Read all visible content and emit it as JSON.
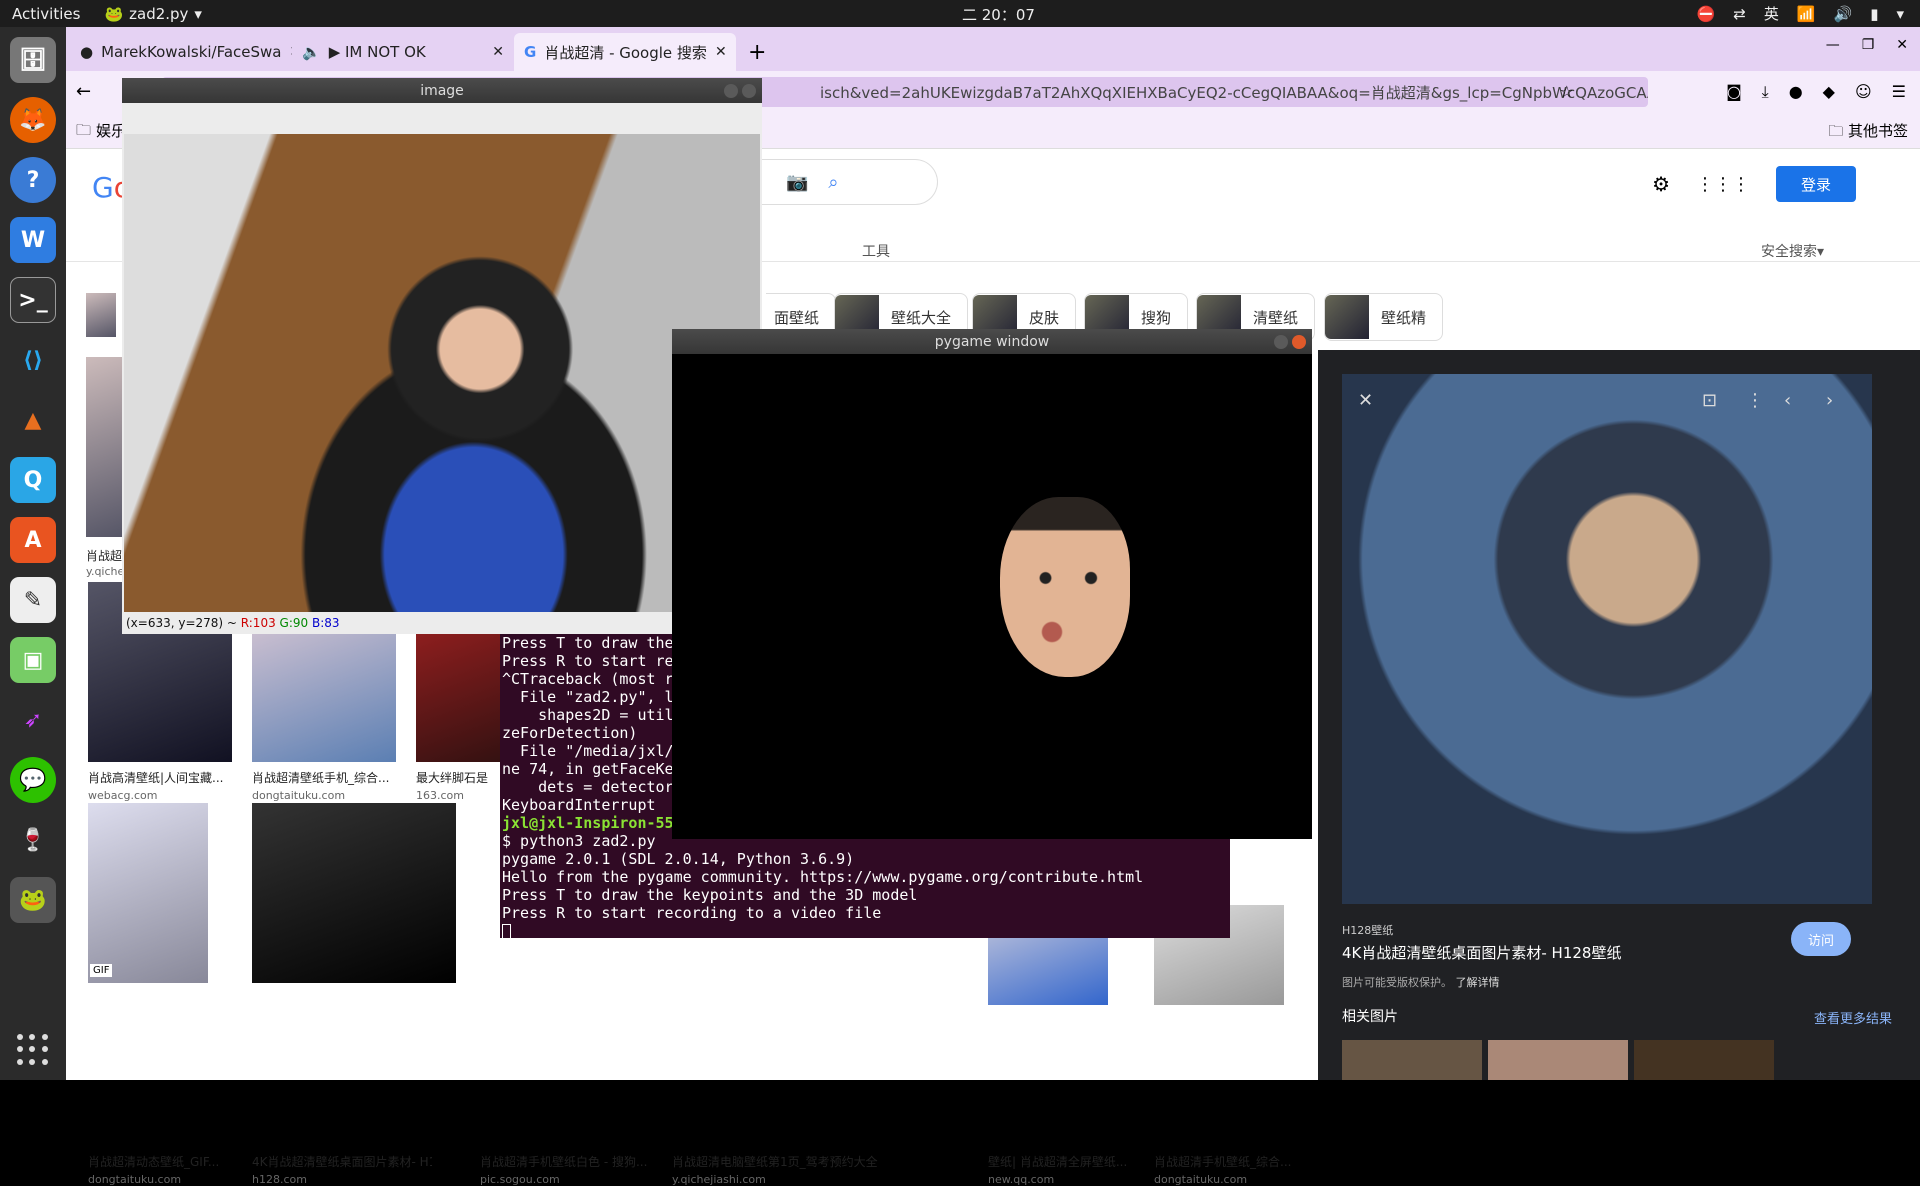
{
  "topbar": {
    "activities": "Activities",
    "app": "zad2.py",
    "clock": "二 20：07",
    "lang": "英"
  },
  "browser": {
    "tabs": [
      {
        "label": "MarekKowalski/FaceSwa"
      },
      {
        "label": "▶ IM NOT OK"
      },
      {
        "label": "肖战超清 - Google 搜索"
      }
    ],
    "url": "isch&ved=2ahUKEwizgdaB7aT2AhXQqXIEHXBaCyEQ2-cCegQIABAA&oq=肖战超清&gs_lcp=CgNpbWcQAzoGCAA",
    "bookmark_left": "娱乐",
    "bookmark_right": "其他书签",
    "tools": "工具",
    "safe": "安全搜索▾",
    "login": "登录",
    "chips": [
      "面壁纸",
      "壁纸大全",
      "皮肤",
      "搜狗",
      "清壁纸",
      "壁纸精"
    ],
    "results": [
      {
        "cap": "肖战超",
        "src": "y.qiche"
      },
      {
        "cap": "肖战高清壁纸|人间宝藏...",
        "src": "webacg.com"
      },
      {
        "cap": "肖战超清壁纸手机_综合...",
        "src": "dongtaituku.com"
      },
      {
        "cap": "最大绊脚石是",
        "src": "163.com"
      },
      {
        "cap": "肖战超清动态壁纸_GIF...",
        "src": "dongtaituku.com"
      },
      {
        "cap": "4K肖战超清壁纸桌面图片素材- H1...",
        "src": "h128.com"
      },
      {
        "cap": "肖战超清手机壁纸白色 - 搜狗...",
        "src": "pic.sogou.com"
      },
      {
        "cap": "肖战超清电脑壁纸第1页_驾考预约大全",
        "src": "y.qichejiashi.com"
      },
      {
        "cap": "壁纸| 肖战超清全屏壁纸...",
        "src": "new.qq.com"
      },
      {
        "cap": "肖战超清手机壁纸_综合...",
        "src": "dongtaituku.com"
      }
    ],
    "gif": "GIF",
    "panel": {
      "site": "H128壁纸",
      "title": "4K肖战超清壁纸桌面图片素材- H128壁纸",
      "note": "图片可能受版权保护。",
      "learn": "了解详情",
      "visit": "访问",
      "related": "相关图片",
      "more": "查看更多结果"
    }
  },
  "image_window": {
    "title": "image",
    "status_prefix": "(x=633, y=278) ~ ",
    "r": "R:103",
    "g": "G:90",
    "b": "B:83"
  },
  "pygame_window": {
    "title": "pygame window"
  },
  "terminal": {
    "lines": [
      "Press T to draw the",
      "Press R to start re",
      "^CTraceback (most r",
      "  File \"zad2.py\", l",
      "    shapes2D = util",
      "zeForDetection)",
      "  File \"/media/jxl/",
      "ne 74, in getFaceKe",
      "    dets = detector",
      "KeyboardInterrupt"
    ],
    "prompt": "jxl@jxl-Inspiron-55",
    "lines2": [
      "$ python3 zad2.py",
      "pygame 2.0.1 (SDL 2.0.14, Python 3.6.9)",
      "Hello from the pygame community. https://www.pygame.org/contribute.html",
      "Press T to draw the keypoints and the 3D model",
      "Press R to start recording to a video file"
    ]
  }
}
